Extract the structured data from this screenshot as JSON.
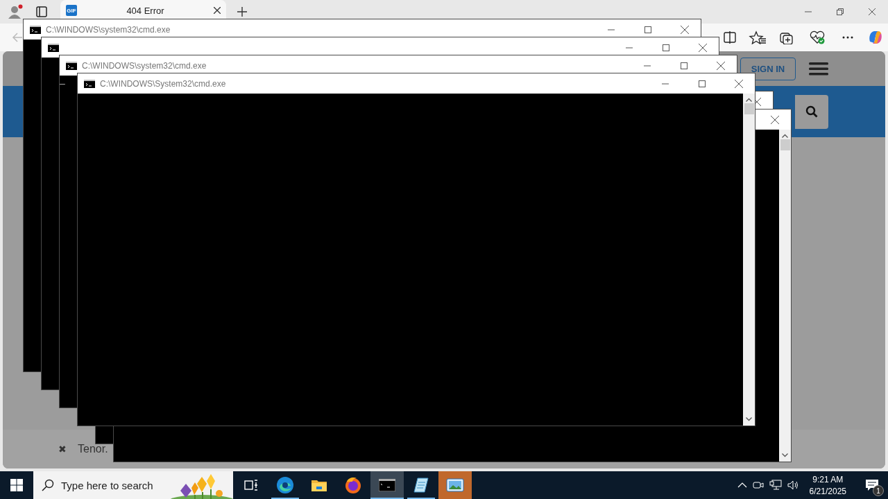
{
  "browser": {
    "tab": {
      "favicon": "GIF",
      "title": "404 Error",
      "selected": true
    },
    "page": {
      "sign_in": "SIGN IN",
      "dismiss": "✖",
      "footer_text": "Tenor."
    }
  },
  "cmd_windows": [
    {
      "title": "C:\\WINDOWS\\system32\\cmd.exe",
      "active": false,
      "min_max": true
    },
    {
      "active": false,
      "min_max": true
    },
    {
      "title": "C:\\WINDOWS\\system32\\cmd.exe",
      "active": false,
      "min_max": true,
      "console_text": "_"
    },
    {
      "title": "C:\\WINDOWS\\System32\\cmd.exe",
      "active": false,
      "min_max": true,
      "scrollbar": true
    },
    {
      "active": false
    },
    {
      "active": false,
      "scrollbar": true
    }
  ],
  "taskbar": {
    "search": {
      "placeholder": "Type here to search"
    },
    "apps": [
      {
        "kind": "task-view",
        "running": false,
        "selected": false,
        "flashing": false
      },
      {
        "kind": "edge",
        "running": true,
        "selected": false,
        "flashing": false
      },
      {
        "kind": "explorer",
        "running": false,
        "selected": false,
        "flashing": false
      },
      {
        "kind": "firefox",
        "running": false,
        "selected": false,
        "flashing": false
      },
      {
        "kind": "terminal",
        "running": true,
        "selected": true,
        "flashing": false
      },
      {
        "kind": "notepad",
        "running": true,
        "selected": false,
        "flashing": false
      },
      {
        "kind": "photos",
        "running": false,
        "selected": false,
        "flashing": true
      }
    ],
    "clock": {
      "time": "9:21 AM",
      "date": "6/21/2025"
    },
    "notifications": {
      "count": "1"
    }
  }
}
